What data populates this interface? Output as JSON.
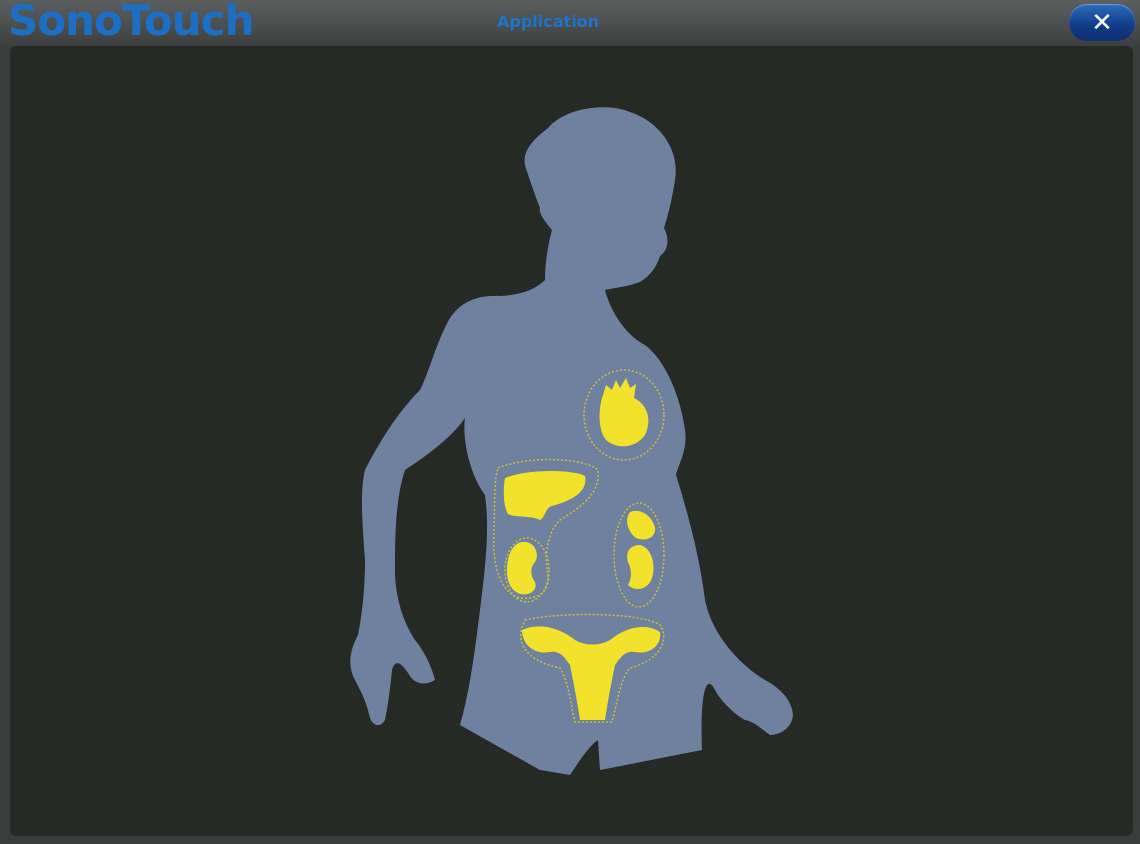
{
  "header": {
    "brand": "SonoTouch",
    "title": "Application",
    "close_glyph": "✕"
  },
  "colors": {
    "brand": "#1c6fc4",
    "panel_bg": "#252a27",
    "silhouette": "#6e819e",
    "organ_fill": "#f2e22a",
    "organ_outline": "#c9c23a"
  },
  "selector": {
    "icons": [
      "female-silhouette",
      "heart-icon",
      "liver-icon",
      "left-kidney-icon",
      "right-kidney-icon",
      "uterus-icon"
    ]
  }
}
